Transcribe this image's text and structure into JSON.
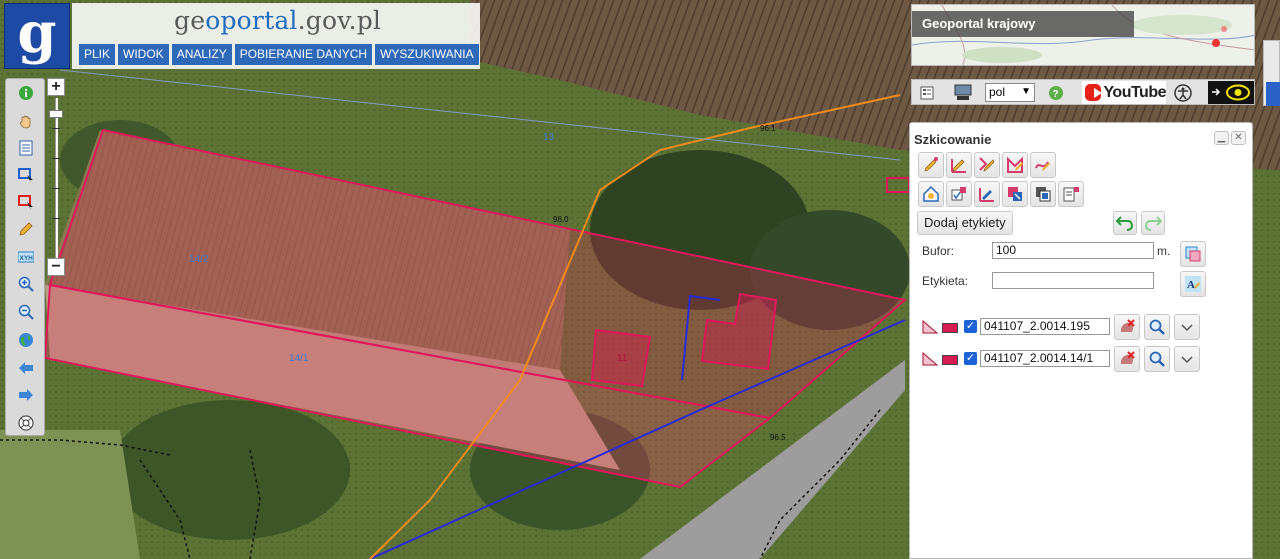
{
  "header": {
    "brand_prefix": "ge",
    "brand_o": "o",
    "brand_rest": "portal",
    "brand_suffix": ".gov.pl",
    "logo_letter": "g",
    "menu": [
      "PLIK",
      "WIDOK",
      "ANALIZY",
      "POBIERANIE DANYCH",
      "WYSZUKIWANIA"
    ]
  },
  "map": {
    "parcel_labels": [
      "13",
      "14/2",
      "14/1",
      "11"
    ],
    "line_labels": [
      "96.1",
      "96.0",
      "96.5"
    ]
  },
  "overview": {
    "title": "Geoportal krajowy"
  },
  "tool_strip": {
    "language": "pol",
    "youtube_label": "YouTube"
  },
  "left_toolbar": {
    "icons": [
      "info-icon",
      "pan-hand-icon",
      "layers-list-icon",
      "select-area-icon",
      "select-red-icon",
      "pencil-icon",
      "xyh-icon",
      "zoom-in-icon",
      "zoom-out-icon",
      "globe-icon",
      "back-arrow-icon",
      "forward-arrow-icon",
      "help-circle-icon"
    ],
    "xyh_label": "XYH"
  },
  "zoom": {
    "plus": "+",
    "minus": "−"
  },
  "panel": {
    "title": "Szkicowanie",
    "add_labels_button": "Dodaj etykiety",
    "buffer_label": "Bufor:",
    "buffer_value": "100",
    "buffer_unit": "m.",
    "label_label": "Etykieta:",
    "label_value": "",
    "rows": [
      {
        "name": "041107_2.0014.195"
      },
      {
        "name": "041107_2.0014.14/1"
      }
    ]
  },
  "colors": {
    "parcel_outline": "#e0185a",
    "brand_blue": "#1d4aa5",
    "menu_blue": "#2d69b8",
    "orange_line": "#f28a1c",
    "blue_line": "#2a2ad6"
  }
}
